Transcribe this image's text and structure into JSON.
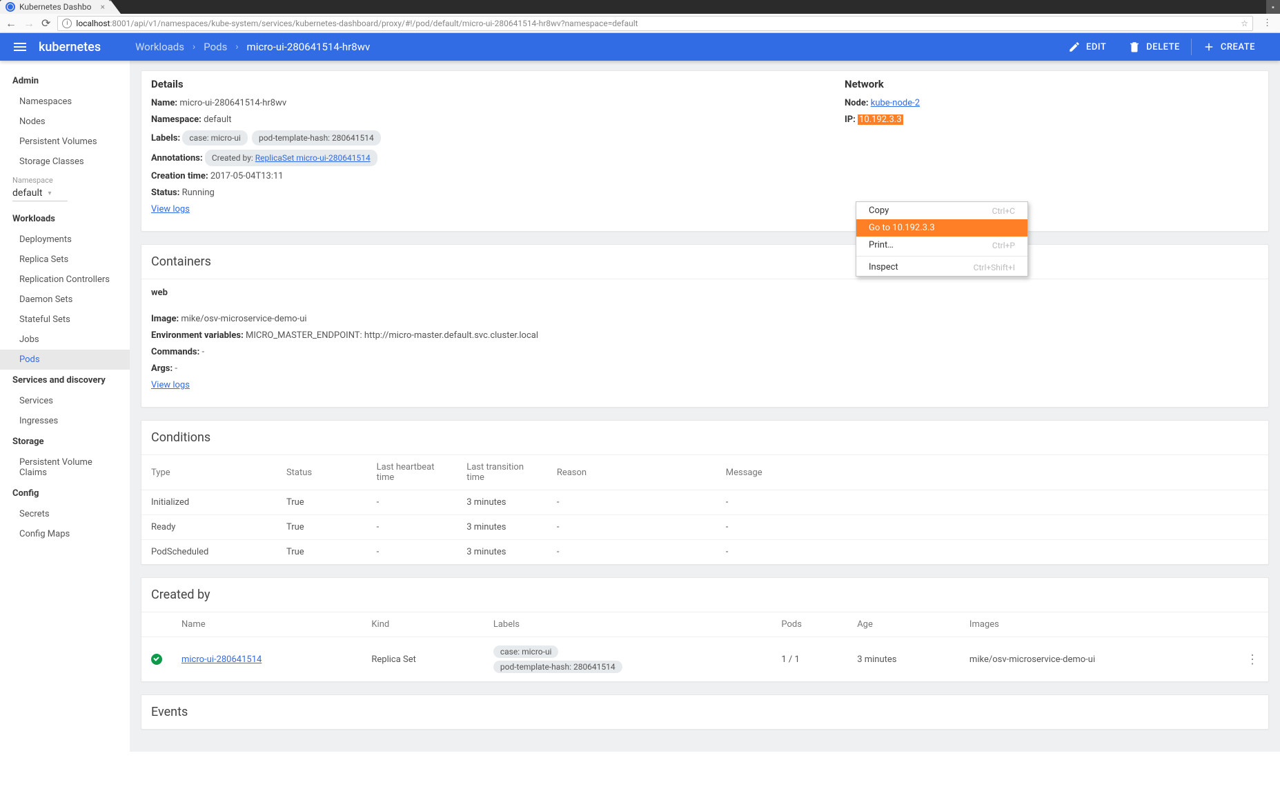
{
  "browser": {
    "tab_title": "Kubernetes Dashbo",
    "url_host": "localhost",
    "url_path": ":8001/api/v1/namespaces/kube-system/services/kubernetes-dashboard/proxy/#!/pod/default/micro-ui-280641514-hr8wv?namespace=default"
  },
  "header": {
    "app_title": "kubernetes",
    "crumbs": [
      "Workloads",
      "Pods",
      "micro-ui-280641514-hr8wv"
    ],
    "actions": {
      "edit": "EDIT",
      "delete": "DELETE",
      "create": "CREATE"
    }
  },
  "sidebar": {
    "admin_heading": "Admin",
    "admin_items": [
      "Namespaces",
      "Nodes",
      "Persistent Volumes",
      "Storage Classes"
    ],
    "ns_label": "Namespace",
    "ns_value": "default",
    "workloads_heading": "Workloads",
    "workloads_items": [
      "Deployments",
      "Replica Sets",
      "Replication Controllers",
      "Daemon Sets",
      "Stateful Sets",
      "Jobs",
      "Pods"
    ],
    "workloads_active_index": 6,
    "svc_heading": "Services and discovery",
    "svc_items": [
      "Services",
      "Ingresses"
    ],
    "storage_heading": "Storage",
    "storage_items": [
      "Persistent Volume Claims"
    ],
    "config_heading": "Config",
    "config_items": [
      "Secrets",
      "Config Maps"
    ]
  },
  "details": {
    "title": "Details",
    "name_k": "Name:",
    "name_v": "micro-ui-280641514-hr8wv",
    "ns_k": "Namespace:",
    "ns_v": "default",
    "labels_k": "Labels:",
    "labels": [
      "case: micro-ui",
      "pod-template-hash: 280641514"
    ],
    "ann_k": "Annotations:",
    "ann_prefix": "Created by: ",
    "ann_link": "ReplicaSet micro-ui-280641514",
    "ctime_k": "Creation time:",
    "ctime_v": "2017-05-04T13:11",
    "status_k": "Status:",
    "status_v": "Running",
    "view_logs": "View logs",
    "net_title": "Network",
    "node_k": "Node:",
    "node_link": "kube-node-2",
    "ip_k": "IP:",
    "ip_v": "10.192.3.3"
  },
  "containers": {
    "title": "Containers",
    "name": "web",
    "image_k": "Image:",
    "image_v": "mike/osv-microservice-demo-ui",
    "env_k": "Environment variables:",
    "env_v": "MICRO_MASTER_ENDPOINT: http://micro-master.default.svc.cluster.local",
    "cmd_k": "Commands:",
    "cmd_v": "-",
    "args_k": "Args:",
    "args_v": "-",
    "view_logs": "View logs"
  },
  "conditions": {
    "title": "Conditions",
    "headers": [
      "Type",
      "Status",
      "Last heartbeat time",
      "Last transition time",
      "Reason",
      "Message"
    ],
    "rows": [
      [
        "Initialized",
        "True",
        "-",
        "3 minutes",
        "-",
        "-"
      ],
      [
        "Ready",
        "True",
        "-",
        "3 minutes",
        "-",
        "-"
      ],
      [
        "PodScheduled",
        "True",
        "-",
        "3 minutes",
        "-",
        "-"
      ]
    ]
  },
  "createdby": {
    "title": "Created by",
    "headers": [
      "Name",
      "Kind",
      "Labels",
      "Pods",
      "Age",
      "Images"
    ],
    "row": {
      "name": "micro-ui-280641514",
      "kind": "Replica Set",
      "labels": [
        "case: micro-ui",
        "pod-template-hash: 280641514"
      ],
      "pods": "1 / 1",
      "age": "3 minutes",
      "images": "mike/osv-microservice-demo-ui"
    }
  },
  "events": {
    "title": "Events"
  },
  "context_menu": {
    "items": [
      {
        "label": "Copy",
        "shortcut": "Ctrl+C",
        "active": false
      },
      {
        "label": "Go to 10.192.3.3",
        "shortcut": "",
        "active": true
      },
      {
        "label": "Print…",
        "shortcut": "Ctrl+P",
        "active": false
      },
      {
        "sep": true
      },
      {
        "label": "Inspect",
        "shortcut": "Ctrl+Shift+I",
        "active": false
      }
    ]
  }
}
